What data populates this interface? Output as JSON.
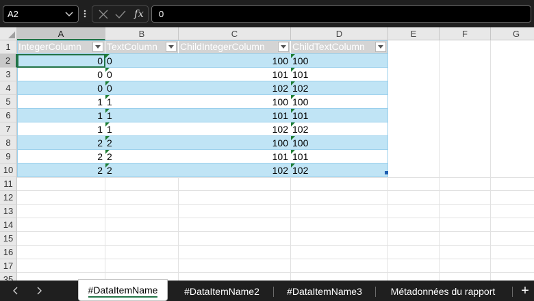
{
  "formula_bar": {
    "name_box": "A2",
    "fx_label": "fx",
    "formula_value": "0"
  },
  "grid": {
    "columns": [
      "A",
      "B",
      "C",
      "D",
      "E",
      "F",
      "G"
    ],
    "rows": [
      "1",
      "2",
      "3",
      "4",
      "5",
      "6",
      "7",
      "8",
      "9",
      "10",
      "11",
      "12",
      "13",
      "14",
      "15",
      "16",
      "17",
      "35"
    ],
    "selected_cell": "A2"
  },
  "table": {
    "headers": [
      "IntegerColumn",
      "TextColumn",
      "ChildIntegerColumn",
      "ChildTextColumn"
    ],
    "data": [
      [
        "0",
        "0",
        "100",
        "100"
      ],
      [
        "0",
        "0",
        "101",
        "101"
      ],
      [
        "0",
        "0",
        "102",
        "102"
      ],
      [
        "1",
        "1",
        "100",
        "100"
      ],
      [
        "1",
        "1",
        "101",
        "101"
      ],
      [
        "1",
        "1",
        "102",
        "102"
      ],
      [
        "2",
        "2",
        "100",
        "100"
      ],
      [
        "2",
        "2",
        "101",
        "101"
      ],
      [
        "2",
        "2",
        "102",
        "102"
      ]
    ]
  },
  "sheet_tabs": {
    "tabs": [
      "#DataItemName",
      "#DataItemName2",
      "#DataItemName3",
      "Métadonnées du rapport"
    ],
    "active_index": 0,
    "add_label": "+"
  },
  "colors": {
    "band": "#c0e4f5",
    "selection": "#217346",
    "header_bg": "#d4d4d4",
    "error_flag": "#1e7d34"
  }
}
